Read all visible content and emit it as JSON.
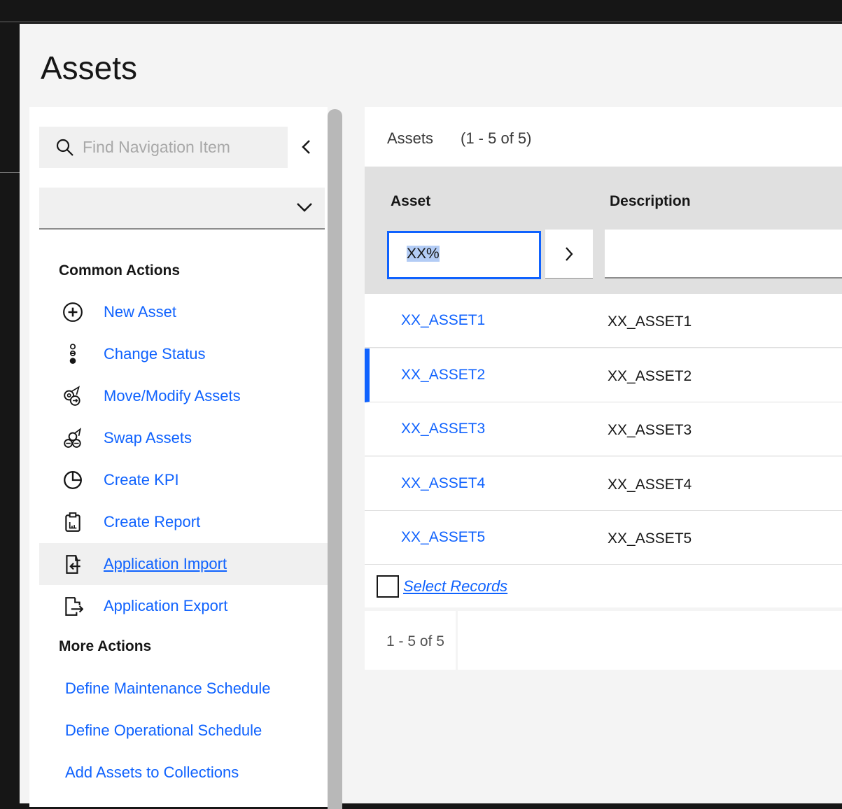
{
  "page": {
    "title": "Assets"
  },
  "nav": {
    "search_placeholder": "Find Navigation Item",
    "common_actions_title": "Common Actions",
    "common_actions": [
      {
        "label": "New Asset",
        "icon": "plus-circle-icon"
      },
      {
        "label": "Change Status",
        "icon": "status-icon"
      },
      {
        "label": "Move/Modify Assets",
        "icon": "move-assets-icon"
      },
      {
        "label": "Swap Assets",
        "icon": "swap-assets-icon"
      },
      {
        "label": "Create KPI",
        "icon": "pie-chart-icon"
      },
      {
        "label": "Create Report",
        "icon": "report-icon"
      },
      {
        "label": "Application Import",
        "icon": "import-icon"
      },
      {
        "label": "Application Export",
        "icon": "export-icon"
      }
    ],
    "more_actions_title": "More Actions",
    "more_actions": [
      "Define Maintenance Schedule",
      "Define Operational Schedule",
      "Add Assets to Collections"
    ]
  },
  "table": {
    "title": "Assets",
    "count": "(1 - 5 of 5)",
    "columns": [
      "Asset",
      "Description"
    ],
    "filter_value": "XX%",
    "rows": [
      {
        "asset": "XX_ASSET1",
        "description": "XX_ASSET1"
      },
      {
        "asset": "XX_ASSET2",
        "description": "XX_ASSET2"
      },
      {
        "asset": "XX_ASSET3",
        "description": "XX_ASSET3"
      },
      {
        "asset": "XX_ASSET4",
        "description": "XX_ASSET4"
      },
      {
        "asset": "XX_ASSET5",
        "description": "XX_ASSET5"
      }
    ],
    "select_records": "Select Records",
    "pagination": "1 - 5 of 5"
  },
  "colors": {
    "accent": "#0f62fe"
  }
}
